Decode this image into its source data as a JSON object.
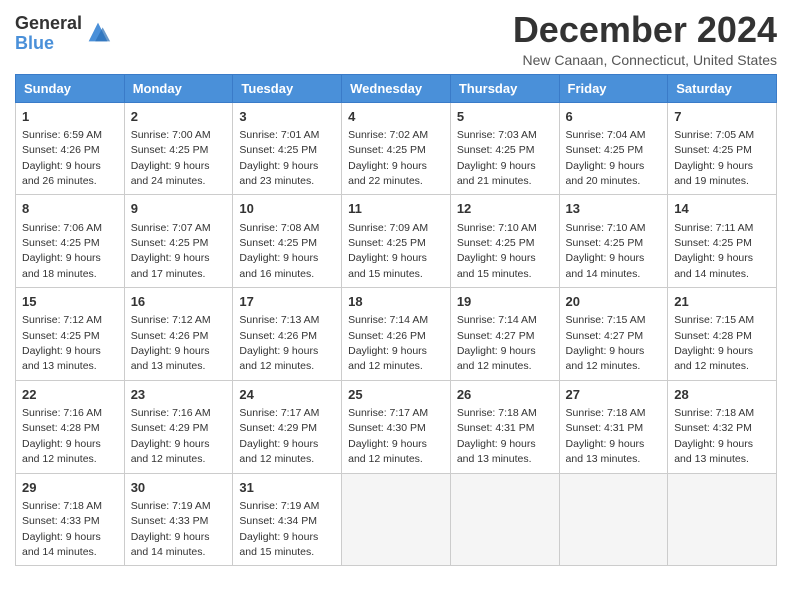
{
  "header": {
    "logo_line1": "General",
    "logo_line2": "Blue",
    "month": "December 2024",
    "location": "New Canaan, Connecticut, United States"
  },
  "weekdays": [
    "Sunday",
    "Monday",
    "Tuesday",
    "Wednesday",
    "Thursday",
    "Friday",
    "Saturday"
  ],
  "weeks": [
    [
      {
        "day": "1",
        "sunrise": "6:59 AM",
        "sunset": "4:26 PM",
        "daylight": "9 hours and 26 minutes."
      },
      {
        "day": "2",
        "sunrise": "7:00 AM",
        "sunset": "4:25 PM",
        "daylight": "9 hours and 24 minutes."
      },
      {
        "day": "3",
        "sunrise": "7:01 AM",
        "sunset": "4:25 PM",
        "daylight": "9 hours and 23 minutes."
      },
      {
        "day": "4",
        "sunrise": "7:02 AM",
        "sunset": "4:25 PM",
        "daylight": "9 hours and 22 minutes."
      },
      {
        "day": "5",
        "sunrise": "7:03 AM",
        "sunset": "4:25 PM",
        "daylight": "9 hours and 21 minutes."
      },
      {
        "day": "6",
        "sunrise": "7:04 AM",
        "sunset": "4:25 PM",
        "daylight": "9 hours and 20 minutes."
      },
      {
        "day": "7",
        "sunrise": "7:05 AM",
        "sunset": "4:25 PM",
        "daylight": "9 hours and 19 minutes."
      }
    ],
    [
      {
        "day": "8",
        "sunrise": "7:06 AM",
        "sunset": "4:25 PM",
        "daylight": "9 hours and 18 minutes."
      },
      {
        "day": "9",
        "sunrise": "7:07 AM",
        "sunset": "4:25 PM",
        "daylight": "9 hours and 17 minutes."
      },
      {
        "day": "10",
        "sunrise": "7:08 AM",
        "sunset": "4:25 PM",
        "daylight": "9 hours and 16 minutes."
      },
      {
        "day": "11",
        "sunrise": "7:09 AM",
        "sunset": "4:25 PM",
        "daylight": "9 hours and 15 minutes."
      },
      {
        "day": "12",
        "sunrise": "7:10 AM",
        "sunset": "4:25 PM",
        "daylight": "9 hours and 15 minutes."
      },
      {
        "day": "13",
        "sunrise": "7:10 AM",
        "sunset": "4:25 PM",
        "daylight": "9 hours and 14 minutes."
      },
      {
        "day": "14",
        "sunrise": "7:11 AM",
        "sunset": "4:25 PM",
        "daylight": "9 hours and 14 minutes."
      }
    ],
    [
      {
        "day": "15",
        "sunrise": "7:12 AM",
        "sunset": "4:25 PM",
        "daylight": "9 hours and 13 minutes."
      },
      {
        "day": "16",
        "sunrise": "7:12 AM",
        "sunset": "4:26 PM",
        "daylight": "9 hours and 13 minutes."
      },
      {
        "day": "17",
        "sunrise": "7:13 AM",
        "sunset": "4:26 PM",
        "daylight": "9 hours and 12 minutes."
      },
      {
        "day": "18",
        "sunrise": "7:14 AM",
        "sunset": "4:26 PM",
        "daylight": "9 hours and 12 minutes."
      },
      {
        "day": "19",
        "sunrise": "7:14 AM",
        "sunset": "4:27 PM",
        "daylight": "9 hours and 12 minutes."
      },
      {
        "day": "20",
        "sunrise": "7:15 AM",
        "sunset": "4:27 PM",
        "daylight": "9 hours and 12 minutes."
      },
      {
        "day": "21",
        "sunrise": "7:15 AM",
        "sunset": "4:28 PM",
        "daylight": "9 hours and 12 minutes."
      }
    ],
    [
      {
        "day": "22",
        "sunrise": "7:16 AM",
        "sunset": "4:28 PM",
        "daylight": "9 hours and 12 minutes."
      },
      {
        "day": "23",
        "sunrise": "7:16 AM",
        "sunset": "4:29 PM",
        "daylight": "9 hours and 12 minutes."
      },
      {
        "day": "24",
        "sunrise": "7:17 AM",
        "sunset": "4:29 PM",
        "daylight": "9 hours and 12 minutes."
      },
      {
        "day": "25",
        "sunrise": "7:17 AM",
        "sunset": "4:30 PM",
        "daylight": "9 hours and 12 minutes."
      },
      {
        "day": "26",
        "sunrise": "7:18 AM",
        "sunset": "4:31 PM",
        "daylight": "9 hours and 13 minutes."
      },
      {
        "day": "27",
        "sunrise": "7:18 AM",
        "sunset": "4:31 PM",
        "daylight": "9 hours and 13 minutes."
      },
      {
        "day": "28",
        "sunrise": "7:18 AM",
        "sunset": "4:32 PM",
        "daylight": "9 hours and 13 minutes."
      }
    ],
    [
      {
        "day": "29",
        "sunrise": "7:18 AM",
        "sunset": "4:33 PM",
        "daylight": "9 hours and 14 minutes."
      },
      {
        "day": "30",
        "sunrise": "7:19 AM",
        "sunset": "4:33 PM",
        "daylight": "9 hours and 14 minutes."
      },
      {
        "day": "31",
        "sunrise": "7:19 AM",
        "sunset": "4:34 PM",
        "daylight": "9 hours and 15 minutes."
      },
      null,
      null,
      null,
      null
    ]
  ],
  "labels": {
    "sunrise": "Sunrise:",
    "sunset": "Sunset:",
    "daylight": "Daylight:"
  }
}
